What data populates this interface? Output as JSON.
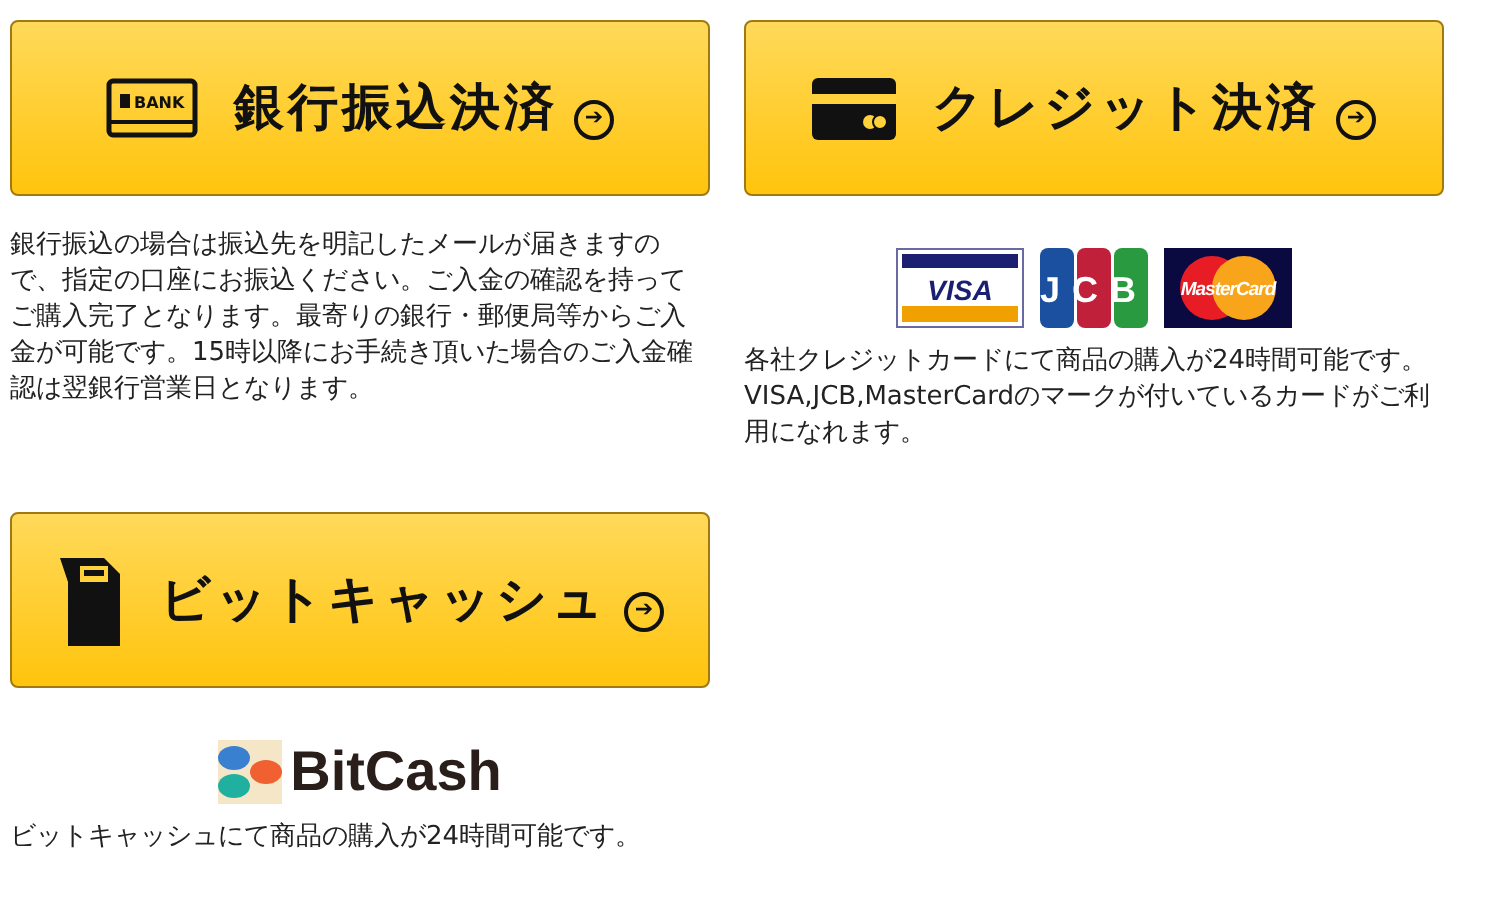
{
  "methods": [
    {
      "kind": "bank",
      "label": "銀行振込決済",
      "arrow": "➔",
      "icon_text": "BANK",
      "description": "銀行振込の場合は振込先を明記したメールが届きますので、指定の口座にお振込ください。ご入金の確認を持ってご購入完了となります。最寄りの銀行・郵便局等からご入金が可能です。15時以降にお手続き頂いた場合のご入金確認は翌銀行営業日となります。"
    },
    {
      "kind": "credit",
      "label": "クレジット決済",
      "arrow": "➔",
      "logos": [
        {
          "kind": "visa",
          "text": "VISA"
        },
        {
          "kind": "jcb",
          "text": "JCB"
        },
        {
          "kind": "mastercard",
          "text": "MasterCard"
        }
      ],
      "description": "各社クレジットカードにて商品の購入が24時間可能です。VISA,JCB,MasterCardのマークが付いているカードがご利用になれます。"
    },
    {
      "kind": "bitcash",
      "label": "ビットキャッシュ",
      "arrow": "➔",
      "logos": [
        {
          "kind": "bitcash",
          "text": "BitCash"
        }
      ],
      "description": "ビットキャッシュにて商品の購入が24時間可能です。"
    }
  ]
}
